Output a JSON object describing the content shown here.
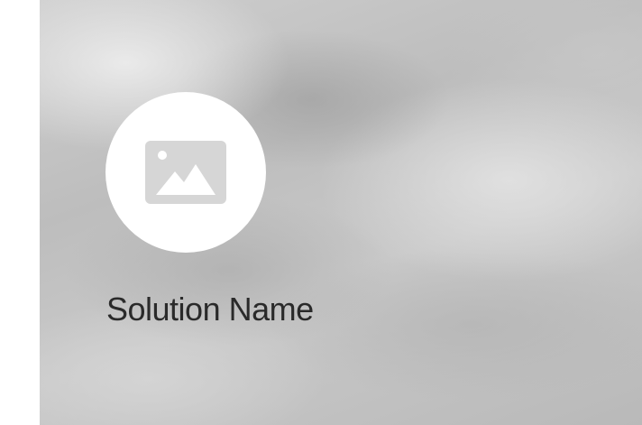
{
  "card": {
    "title": "Solution Name",
    "icon": "image-placeholder-icon"
  },
  "colors": {
    "background_tint": "#c4c4c4",
    "avatar_background": "#ffffff",
    "icon_fill": "#d6d6d6",
    "title_text": "#2a2a2a"
  }
}
